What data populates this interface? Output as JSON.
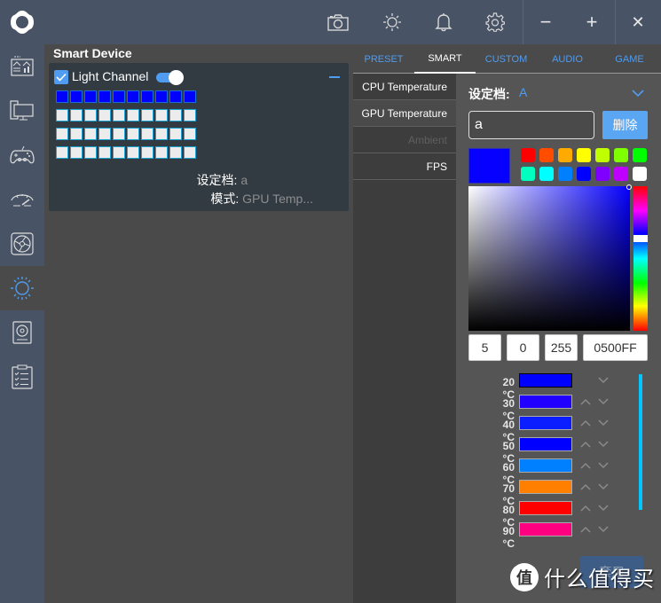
{
  "titlebar": {
    "icons": [
      "camera-icon",
      "brightness-icon",
      "bell-icon",
      "gear-icon"
    ],
    "minimize": "−",
    "maximize": "+",
    "close": "✕"
  },
  "sidebar": {
    "items": [
      {
        "name": "dashboard",
        "icon": "dashboard-icon"
      },
      {
        "name": "devices",
        "icon": "monitor-icon"
      },
      {
        "name": "game",
        "icon": "gamepad-icon"
      },
      {
        "name": "performance",
        "icon": "speedometer-icon"
      },
      {
        "name": "fan",
        "icon": "fan-icon"
      },
      {
        "name": "lighting",
        "icon": "sun-icon",
        "active": true
      },
      {
        "name": "storage",
        "icon": "disk-icon"
      },
      {
        "name": "log",
        "icon": "clipboard-icon"
      }
    ]
  },
  "device_panel": {
    "title": "Smart Device",
    "channel": {
      "label": "Light Channel",
      "checked": true,
      "enabled": true,
      "led_rows": 4,
      "led_cols": 10,
      "lit_rows": 1,
      "lit_color": "#0000ff",
      "preset_label": "设定档:",
      "preset_value": "a",
      "mode_label": "模式:",
      "mode_value": "GPU Temp..."
    }
  },
  "tabs": [
    {
      "label": "PRESET",
      "active": false
    },
    {
      "label": "SMART",
      "active": true
    },
    {
      "label": "CUSTOM",
      "active": false
    },
    {
      "label": "AUDIO",
      "active": false
    },
    {
      "label": "GAME",
      "active": false
    }
  ],
  "sources": [
    {
      "label": "CPU Temperature",
      "state": "normal"
    },
    {
      "label": "GPU Temperature",
      "state": "selected"
    },
    {
      "label": "Ambient",
      "state": "disabled"
    },
    {
      "label": "FPS",
      "state": "normal"
    }
  ],
  "editor": {
    "preset_label": "设定档:",
    "preset_value": "A",
    "name_input": "a",
    "delete_label": "删除",
    "current_color": "#0500ff",
    "swatches": [
      "#ff0000",
      "#ff4d00",
      "#ffaa00",
      "#ffff00",
      "#bfff00",
      "#80ff00",
      "#00ff00",
      "#00ffbf",
      "#00ffff",
      "#0080ff",
      "#0000ff",
      "#8000ff",
      "#bf00ff",
      "#ffffff"
    ],
    "r": "5",
    "g": "0",
    "b": "255",
    "hex": "0500FF",
    "stops": [
      {
        "label": "20 °C",
        "color": "#0000ff",
        "up": false
      },
      {
        "label": "30 °C",
        "color": "#2200ff",
        "up": true
      },
      {
        "label": "40 °C",
        "color": "#0a1eff",
        "up": true
      },
      {
        "label": "50 °C",
        "color": "#0000ff",
        "up": true
      },
      {
        "label": "60 °C",
        "color": "#0080ff",
        "up": true
      },
      {
        "label": "70 °C",
        "color": "#ff8000",
        "up": true
      },
      {
        "label": "80 °C",
        "color": "#ff0000",
        "up": true
      },
      {
        "label": "90 °C",
        "color": "#ff0080",
        "up": true
      }
    ],
    "apply_label": "套用"
  },
  "watermark": {
    "badge": "值",
    "text": "什么值得买"
  },
  "colors": {
    "accent": "#4f9cf0",
    "titlebar": "#485366",
    "scroll": "#00c6ff"
  }
}
